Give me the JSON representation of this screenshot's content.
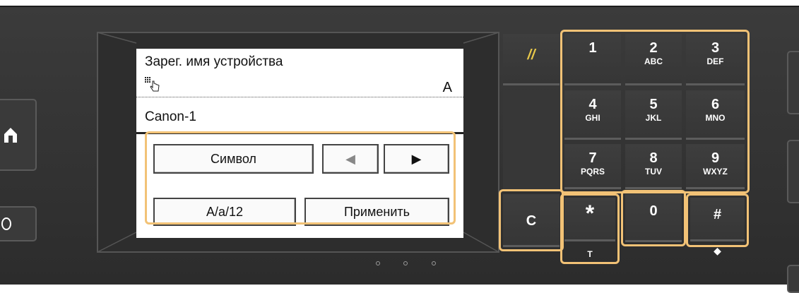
{
  "screen": {
    "title": "Зарег. имя устройства",
    "input_mode": "A",
    "input_value": "Canon-1",
    "buttons": {
      "symbol": "Символ",
      "left_arrow": "◀",
      "right_arrow": "▶",
      "mode_toggle": "A/a/12",
      "apply": "Применить"
    }
  },
  "keypad": {
    "keys": [
      {
        "num": "1",
        "letters": ""
      },
      {
        "num": "2",
        "letters": "ABC"
      },
      {
        "num": "3",
        "letters": "DEF"
      },
      {
        "num": "4",
        "letters": "GHI"
      },
      {
        "num": "5",
        "letters": "JKL"
      },
      {
        "num": "6",
        "letters": "MNO"
      },
      {
        "num": "7",
        "letters": "PQRS"
      },
      {
        "num": "8",
        "letters": "TUV"
      },
      {
        "num": "9",
        "letters": "WXYZ"
      }
    ],
    "clear_label": "C",
    "star_label": "*",
    "zero_label": "0",
    "hash_label": "#",
    "star_sub_label": "T",
    "hash_sub_label": "◆",
    "function_key_symbol": "//"
  },
  "colors": {
    "highlight": "#f2c276",
    "function_key": "#e8c84a",
    "panel": "#333333"
  },
  "icons": {
    "cursor": "hand-pointer-icon",
    "home": "home-icon"
  }
}
